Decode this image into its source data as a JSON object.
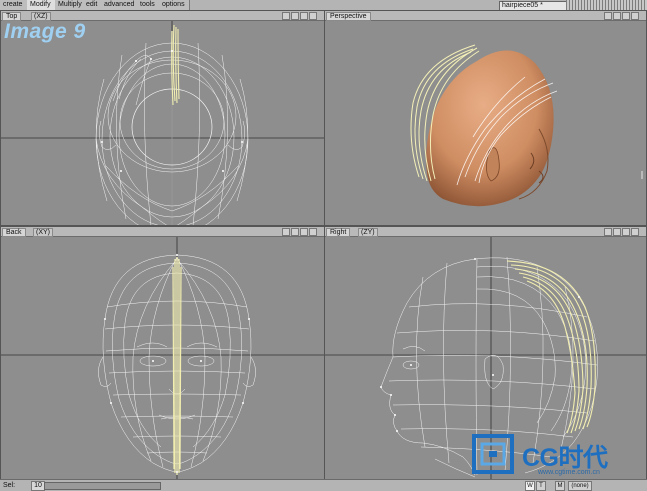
{
  "toolbar": {
    "tabs": [
      {
        "label": "create"
      },
      {
        "label": "Modify",
        "active": true
      },
      {
        "label": "Multiply"
      },
      {
        "label": "edit"
      },
      {
        "label": "advanced"
      },
      {
        "label": "tools"
      },
      {
        "label": "options"
      }
    ],
    "object_name": "hairpiece05 *"
  },
  "watermark": "Image 9",
  "viewports": {
    "top": {
      "title": "Top",
      "axis": "(XZ)"
    },
    "perspective": {
      "title": "Perspective",
      "axis": ""
    },
    "back": {
      "title": "Back",
      "axis": "(XY)"
    },
    "right": {
      "title": "Right",
      "axis": "(ZY)"
    }
  },
  "statusbar": {
    "sel_label": "Sel:",
    "sel_value": "10",
    "buttons": [
      "W",
      "T",
      "M",
      "(none)"
    ]
  },
  "logo": {
    "text": "CG时代",
    "url": "www.cgtime.com.cn"
  },
  "colors": {
    "viewport_bg": "#8e8e8e",
    "wireframe": "#ffffff",
    "hair_guides": "#f2eeb0",
    "skin": "#d6956c",
    "watermark": "#9fd0f2",
    "logo": "#1f6fc0"
  }
}
